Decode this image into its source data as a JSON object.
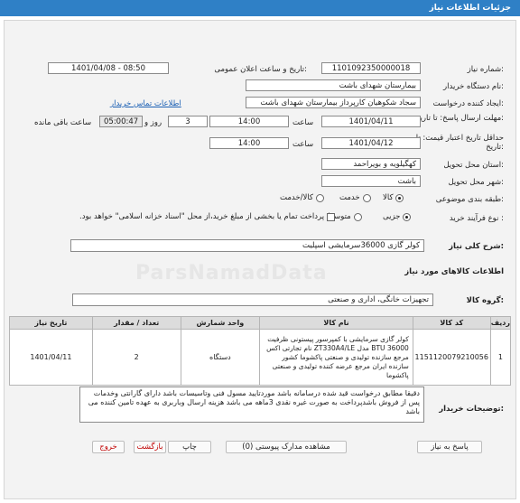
{
  "header": {
    "title": "جزئیات اطلاعات نیاز"
  },
  "fields": {
    "need_number_label": "شماره نیاز:",
    "need_number": "1101092350000018",
    "announce_label": "تاریخ و ساعت اعلان عمومی:",
    "announce_value": "1401/04/08 - 08:50",
    "buyer_name_label": "نام دستگاه خریدار:",
    "buyer_name": "بیمارستان شهدای باشت",
    "requester_label": "ایجاد کننده درخواست:",
    "requester": "سجاد شکوهیان کارپرداز بیمارستان شهدای باشت",
    "contact_link": "اطلاعات تماس خریدار",
    "deadline_label": "مهلت ارسال پاسخ: تا تاریخ:",
    "deadline_date": "1401/04/11",
    "time_label": "ساعت",
    "deadline_time": "14:00",
    "days": "3",
    "days_label": "روز و",
    "remaining": "05:00:47",
    "remaining_label": "ساعت باقی مانده",
    "min_validity_label": "حداقل تاریخ اعتبار قیمت: تا تاریخ:",
    "validity_date": "1401/04/12",
    "validity_time": "14:00",
    "province_label": "استان محل تحویل:",
    "province": "کهگیلویه و بویراحمد",
    "city_label": "شهر محل تحویل:",
    "city": "باشت",
    "category_label": "طبقه بندی موضوعی:",
    "cat_goods": "کالا",
    "cat_service": "خدمت",
    "cat_goods_service": "کالا/خدمت",
    "process_label": "نوع فرآیند خرید :",
    "proc_partial": "جزیی",
    "proc_medium": "متوسط",
    "payment_note": "پرداخت تمام یا بخشی از مبلغ خرید،از محل \"اسناد خزانه اسلامی\" خواهد بود."
  },
  "summary": {
    "label": "شرح کلی نیاز:",
    "value": "کولر گازی 36000سرمایشی اسپلیت"
  },
  "goods_info": {
    "title": "اطلاعات کالاهای مورد نیاز"
  },
  "goods_group": {
    "label": "گروه کالا:",
    "value": "تجهیزات خانگی، اداری و صنعتی"
  },
  "table": {
    "headers": [
      "ردیف",
      "کد کالا",
      "نام کالا",
      "واحد شمارش",
      "تعداد / مقدار",
      "تاریخ نیاز"
    ],
    "rows": [
      {
        "row": "1",
        "code": "1151120079210056",
        "name": "کولر گازی سرمایشی با کمپرسور پیستونی ظرفیت 36000 BTU مدل ZT330A4/LE نام تجارتی اکس مرجع سازنده تولیدی و صنعتی پاکشوما کشور سازنده ایران مرجع عرضه کننده تولیدی و صنعتی پاکشوما",
        "unit": "دستگاه",
        "qty": "2",
        "date": "1401/04/11"
      }
    ]
  },
  "buyer_notes": {
    "label": "توضیحات خریدار:",
    "value": "دقیقا مطابق درخواست قید شده درسامانه باشد موردتایید مسول فنی وتاسیسات باشد دارای گارانتی وخدمات پس از فروش باشدپرداخت به صورت غیره نقدی 3ماهه می باشد هزینه ارسال وباربری به عهده تامین کننده می باشد"
  },
  "buttons": {
    "reply": "پاسخ به نیاز",
    "view_docs": "مشاهده مدارک پیوستی (0)",
    "print": "چاپ",
    "back": "بازگشت",
    "exit": "خروج"
  },
  "watermark": "ParsNamadData"
}
